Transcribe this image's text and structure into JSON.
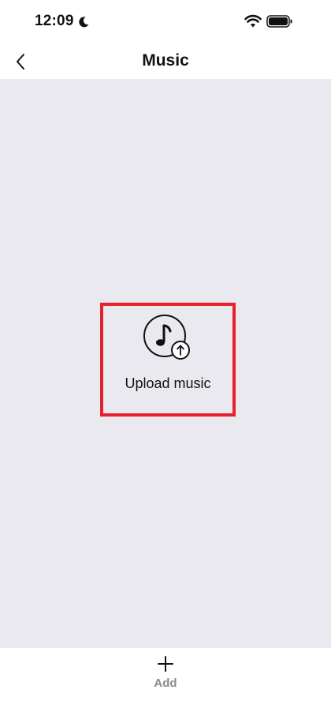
{
  "status_bar": {
    "time": "12:09",
    "icons": [
      "moon-icon",
      "wifi-icon",
      "battery-icon"
    ]
  },
  "header": {
    "title": "Music",
    "back_icon": "chevron-left-icon"
  },
  "main": {
    "upload": {
      "label": "Upload music",
      "icon": "music-upload-icon",
      "highlight_color": "#e8202a"
    },
    "background_color": "#e9e9ef"
  },
  "toolbar": {
    "add_label": "Add",
    "add_icon": "plus-icon"
  }
}
